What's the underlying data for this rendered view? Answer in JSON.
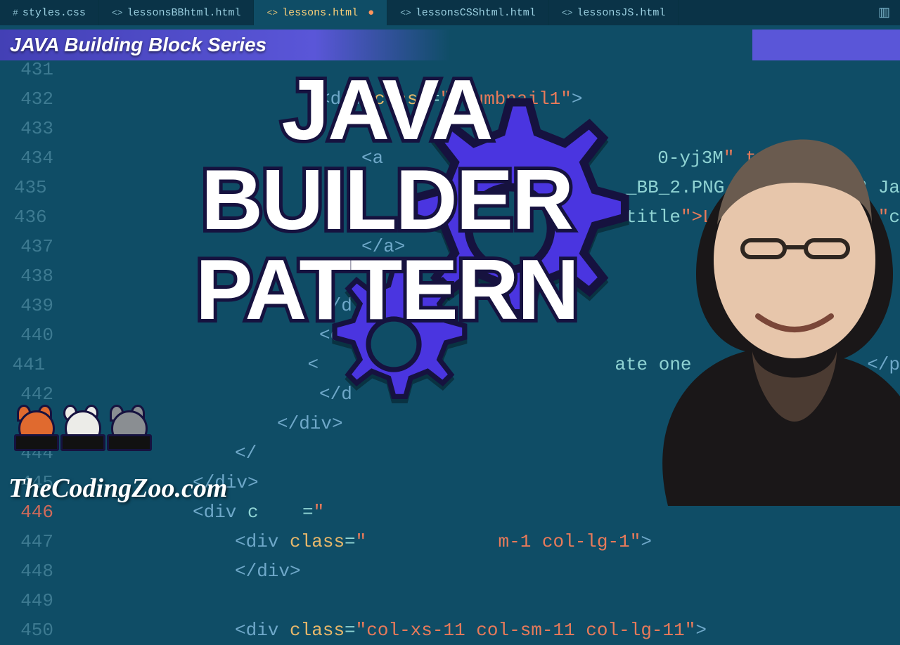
{
  "tabs": [
    {
      "icon": "#",
      "label": "styles.css",
      "active": false,
      "dirty": false
    },
    {
      "icon": "<>",
      "label": "lessonsBBhtml.html",
      "active": false,
      "dirty": false
    },
    {
      "icon": "<>",
      "label": "lessons.html",
      "active": true,
      "dirty": true
    },
    {
      "icon": "<>",
      "label": "lessonsCSShtml.html",
      "active": false,
      "dirty": false
    },
    {
      "icon": "<>",
      "label": "lessonsJS.html",
      "active": false,
      "dirty": false
    }
  ],
  "dirty_marker": "●",
  "banner": {
    "text": "JAVA Building Block Series"
  },
  "hero": {
    "l1": "JAVA",
    "l2": "BUILDER",
    "l3": "PATTERN"
  },
  "site_url": "TheCodingZoo.com",
  "code_lines": [
    {
      "n": 431,
      "indent": 6,
      "raw": ""
    },
    {
      "n": 432,
      "indent": 6,
      "raw": "<div class=\"thumbnail1\">"
    },
    {
      "n": 433,
      "indent": 7,
      "raw": ""
    },
    {
      "n": 434,
      "indent": 7,
      "raw": "<a                         0-yj3M\" targ"
    },
    {
      "n": 435,
      "indent": 7,
      "raw": "                            _BB_2.PNG            2 Ja"
    },
    {
      "n": 436,
      "indent": 7,
      "raw": "                            title\">Le             =\"c"
    },
    {
      "n": 437,
      "indent": 7,
      "raw": "</a>"
    },
    {
      "n": 438,
      "indent": 7,
      "raw": ""
    },
    {
      "n": 439,
      "indent": 6,
      "raw": "</d"
    },
    {
      "n": 440,
      "indent": 6,
      "raw": "<di"
    },
    {
      "n": 441,
      "indent": 7,
      "raw": "<                           ate one                </p"
    },
    {
      "n": 442,
      "indent": 6,
      "raw": "</d"
    },
    {
      "n": 443,
      "indent": 5,
      "raw": "</div>"
    },
    {
      "n": 444,
      "indent": 4,
      "raw": "</"
    },
    {
      "n": 445,
      "indent": 3,
      "raw": "</div>"
    },
    {
      "n": 446,
      "indent": 3,
      "raw": "<div c    =\"",
      "hi": true
    },
    {
      "n": 447,
      "indent": 4,
      "raw": "<div class=\"            m-1 col-lg-1\">"
    },
    {
      "n": 448,
      "indent": 4,
      "raw": "</div>"
    },
    {
      "n": 449,
      "indent": 3,
      "raw": ""
    },
    {
      "n": 450,
      "indent": 4,
      "raw": "<div class=\"col-xs-11 col-sm-11 col-lg-11\">"
    }
  ],
  "panel_icon": "▥"
}
